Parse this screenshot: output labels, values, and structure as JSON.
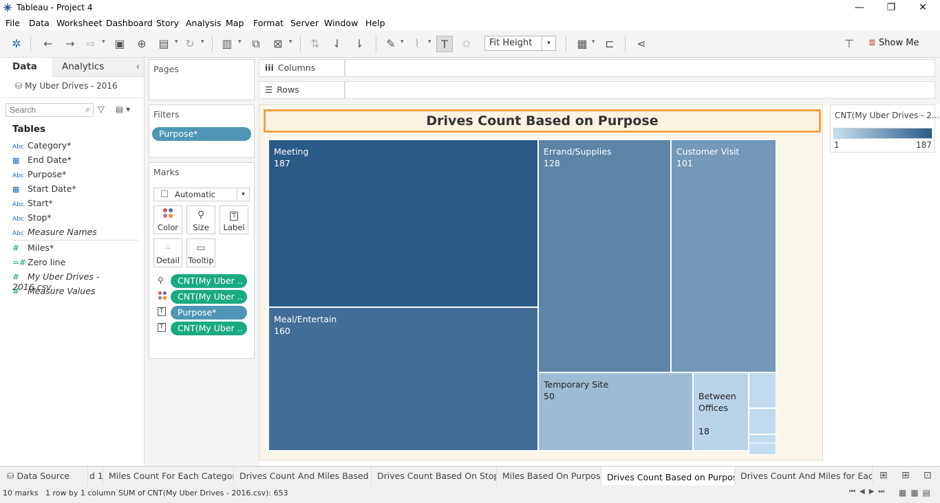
{
  "window": {
    "title": "Tableau - Project 4"
  },
  "menu": [
    "File",
    "Data",
    "Worksheet",
    "Dashboard",
    "Story",
    "Analysis",
    "Map",
    "Format",
    "Server",
    "Window",
    "Help"
  ],
  "toolbar": {
    "fit": "Fit Height",
    "show_me": "Show Me"
  },
  "left_pane": {
    "tabs": {
      "data": "Data",
      "analytics": "Analytics"
    },
    "datasource": "My Uber Drives - 2016",
    "search_placeholder": "Search",
    "tables_heading": "Tables",
    "dimensions": [
      {
        "type": "Abc",
        "name": "Category*",
        "icon": "abc-icon"
      },
      {
        "type": "date",
        "name": "End Date*",
        "icon": "calendar-icon"
      },
      {
        "type": "Abc",
        "name": "Purpose*",
        "icon": "abc-icon"
      },
      {
        "type": "date",
        "name": "Start Date*",
        "icon": "calendar-icon"
      },
      {
        "type": "Abc",
        "name": "Start*",
        "icon": "abc-icon"
      },
      {
        "type": "Abc",
        "name": "Stop*",
        "icon": "abc-icon"
      },
      {
        "type": "Abc",
        "name": "Measure Names",
        "icon": "abc-icon"
      }
    ],
    "measures": [
      {
        "name": "Miles*",
        "icon": "hash-icon"
      },
      {
        "name": "Zero line",
        "icon": "hash-icon"
      },
      {
        "name": "My Uber Drives - 2016.csv...",
        "icon": "hash-icon"
      },
      {
        "name": "Measure Values",
        "icon": "hash-icon"
      }
    ]
  },
  "shelves": {
    "pages": "Pages",
    "filters": "Filters",
    "filter_pill": "Purpose*",
    "marks": "Marks",
    "mark_type": "Automatic",
    "mark_buttons": [
      "Color",
      "Size",
      "Label",
      "Detail",
      "Tooltip"
    ],
    "mark_pills": [
      {
        "label": "CNT(My Uber ..",
        "color": "green",
        "icon": "size-icon"
      },
      {
        "label": "CNT(My Uber ..",
        "color": "green",
        "icon": "color-icon"
      },
      {
        "label": "Purpose*",
        "color": "blue",
        "icon": "label-icon"
      },
      {
        "label": "CNT(My Uber ..",
        "color": "green",
        "icon": "label-icon"
      }
    ],
    "columns": "Columns",
    "rows": "Rows"
  },
  "chart_data": {
    "type": "treemap",
    "title": "Drives Count Based on Purpose",
    "categories": [
      "Meeting",
      "Meal/Entertain",
      "Errand/Supplies",
      "Customer Visit",
      "Temporary Site",
      "Between Offices",
      "",
      "",
      "",
      ""
    ],
    "values": [
      187,
      160,
      128,
      101,
      50,
      18,
      null,
      null,
      null,
      null
    ],
    "labels_shown": [
      {
        "name": "Meeting",
        "value": "187"
      },
      {
        "name": "Meal/Entertain",
        "value": "160"
      },
      {
        "name": "Errand/Supplies",
        "value": "128"
      },
      {
        "name": "Customer Visit",
        "value": "101"
      },
      {
        "name": "Temporary Site",
        "value": "50"
      },
      {
        "name": "Between\nOffices",
        "value": "18"
      }
    ],
    "color_scale": {
      "min": 1,
      "max": 187,
      "low": "#c6e0f2",
      "high": "#2b5a86"
    }
  },
  "legend": {
    "title": "CNT(My Uber Drives - 2...",
    "min": "1",
    "max": "187"
  },
  "sheet_tabs": [
    {
      "label": "Data Source",
      "active": false
    },
    {
      "label": "d 1",
      "active": false
    },
    {
      "label": "Miles Count For Each Category",
      "active": false
    },
    {
      "label": "Drives Count And Miles Based o...",
      "active": false
    },
    {
      "label": "Drives Count Based On Stops",
      "active": false
    },
    {
      "label": "Miles Based On Purpose",
      "active": false
    },
    {
      "label": "Drives Count Based on Purpose",
      "active": true
    },
    {
      "label": "Drives Count And Miles for  Each...",
      "active": false
    }
  ],
  "status": {
    "marks": "10 marks",
    "dims": "1 row by 1 column",
    "sum": "SUM of CNT(My Uber Drives - 2016.csv): 653"
  }
}
